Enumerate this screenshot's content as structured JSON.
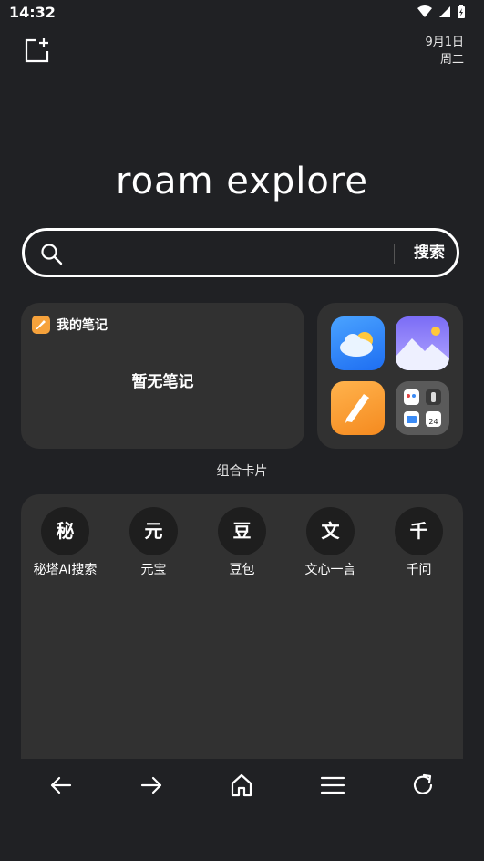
{
  "status_bar": {
    "time": "14:32"
  },
  "date": {
    "day": "9月1日",
    "weekday": "周二"
  },
  "brand": {
    "text": "roam explore"
  },
  "search": {
    "placeholder": "",
    "button_label": "搜索"
  },
  "notes_card": {
    "title": "我的笔记",
    "empty_text": "暂无笔记"
  },
  "apps_card": {
    "label": "组合卡片",
    "folder_badge": "24"
  },
  "shortcuts": [
    {
      "glyph": "秘",
      "label": "秘塔AI搜索"
    },
    {
      "glyph": "元",
      "label": "元宝"
    },
    {
      "glyph": "豆",
      "label": "豆包"
    },
    {
      "glyph": "文",
      "label": "文心一言"
    },
    {
      "glyph": "千",
      "label": "千问"
    }
  ],
  "colors": {
    "background": "#202124",
    "card": "#313131",
    "notes_accent": "#f6a23b"
  }
}
